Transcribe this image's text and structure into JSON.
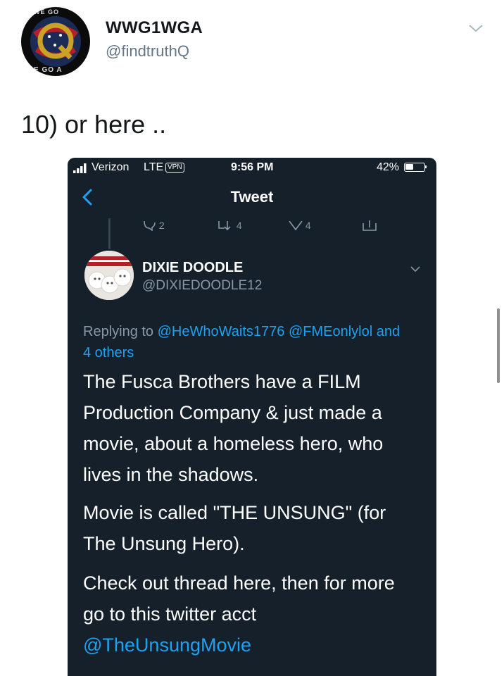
{
  "author": {
    "display_name": "WWG1WGA",
    "handle": "@findtruthQ",
    "avatar_ring_top": "WE GO",
    "avatar_ring_bottom": "E GO A"
  },
  "tweet": {
    "text": "10) or here .."
  },
  "embedded_screenshot": {
    "status_bar": {
      "carrier": "Verizon",
      "network": "LTE",
      "vpn": "VPN",
      "time": "9:56 PM",
      "battery": "42%"
    },
    "nav": {
      "title": "Tweet"
    },
    "actions": {
      "reply_count": "2",
      "retweet_count": "4",
      "like_count": "4"
    },
    "quoted_author": {
      "display_name": "DIXIE DOODLE",
      "handle": "@DIXIEDOODLE12"
    },
    "replying": {
      "prefix": "Replying to",
      "mention_1": "@HeWhoWaits1776",
      "mention_2": "@FMEonlylol",
      "and": "and",
      "others": "4 others"
    },
    "body": {
      "paragraph_1": "The Fusca Brothers have a FILM Production Company & just made a movie, about a homeless hero, who lives in the shadows.",
      "paragraph_2": "Movie is called \"THE UNSUNG\" (for The Unsung Hero).",
      "paragraph_3_text": "Check out thread here, then for more go to this twitter acct",
      "paragraph_3_link": "@TheUnsungMovie"
    }
  },
  "colors": {
    "dark_bg": "#15202b",
    "link_blue": "#1da1f2",
    "muted": "#8899a6"
  }
}
